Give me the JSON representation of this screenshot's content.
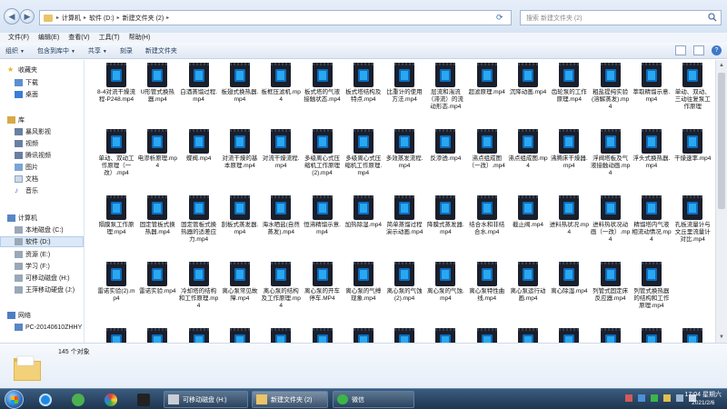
{
  "address": {
    "crumbs": [
      "计算机",
      "软件 (D:)",
      "新建文件夹 (2)"
    ],
    "search_placeholder": "搜索 新建文件夹 (2)"
  },
  "menu": [
    "文件(F)",
    "编辑(E)",
    "查看(V)",
    "工具(T)",
    "帮助(H)"
  ],
  "toolbar": {
    "organize": "组织",
    "include": "包含到库中",
    "share": "共享",
    "burn": "刻录",
    "new_folder": "新建文件夹"
  },
  "nav": {
    "favorites": "收藏夹",
    "downloads": "下载",
    "desktop": "桌面",
    "library": "库",
    "storm": "暴风影视",
    "video": "视频",
    "tencent": "腾讯视频",
    "pictures": "图片",
    "documents": "文档",
    "music": "音乐",
    "computer": "计算机",
    "disk_c": "本地磁盘 (C:)",
    "disk_d": "软件 (D:)",
    "disk_e": "资源 (E:)",
    "disk_f": "学习 (F:)",
    "disk_h": "可移动磁盘 (H:)",
    "disk_j": "王萍移动硬盘 (J:)",
    "network": "网络",
    "pc": "PC-20140610ZHHY"
  },
  "files": [
    "8-4对流干燥流程-P248.mp4",
    "U形管式换热器.mp4",
    "白酒蒸馏过程.mp4",
    "板翅式换热器.mp4",
    "板框压滤机.mp4",
    "板式塔的气液接触状态.mp4",
    "板式塔结构及特点.mp4",
    "比重计的使用方法.mp4",
    "层流和湍流（滞流）的流动形态.mp4",
    "超滤原理.mp4",
    "沉降动画.mp4",
    "齿轮泵的工作原理.mp4",
    "粗盐提纯实验(溶解蒸发).mp4",
    "萃取精馏示意.mp4",
    "单动、双动、三动往复泵工作原理",
    "单动、双动工作原理（一改）.mp4",
    "电渗析原理.mp4",
    "蝶阀.mp4",
    "对流干燥的基本原理.mp4",
    "对流干燥流程.mp4",
    "多级离心式压缩机工作原理(2).mp4",
    "多级离心式压缩机工作原理.mp4",
    "多效蒸发流程.mp4",
    "反渗透.mp4",
    "沸点组成图（一改）.mp4",
    "沸点组成图.mp4",
    "沸腾床干燥器.mp4",
    "浮阀塔板及气液接触动画.mp4",
    "浮头式换热器.mp4",
    "干燥速率.mp4",
    "隔膜泵工作原理.mp4",
    "固定管板式换热器.mp4",
    "固定管板式换热器的适差应力.mp4",
    "刮板式蒸发器.mp4",
    "海水晒盐(自然蒸发).mp4",
    "恒沸精馏示意.mp4",
    "加热除湿.mp4",
    "简单蒸馏过程演示动画.mp4",
    "降膜式蒸发器.mp4",
    "结合水和非结合水.mp4",
    "截止阀.mp4",
    "进料热状况.mp4",
    "进料热状况动画（一改）.mp4",
    "精馏塔内气液相流动情况.mp4",
    "孔板流量计与文丘里流量计对比.mp4",
    "雷诺实验(2).mp4",
    "雷诺实验.mp4",
    "冷却塔的结构和工作原理.mp4",
    "离心泵常见故障.mp4",
    "离心泵的结构及工作原理.mp4",
    "离心泵的开车停车.MP4",
    "离心泵的气缚现象.mp4",
    "离心泵的气蚀 (2).mp4",
    "离心泵的气蚀.mp4",
    "离心泵特性曲线.mp4",
    "离心泵运行动画.mp4",
    "离心除湿.mp4",
    "列管式固定床反应器.mp4",
    "列管式换热器的结构和工作原理.mp4"
  ],
  "details": {
    "count": "145 个对象"
  },
  "taskbar": {
    "task1": "可移动磁盘 (H:)",
    "task2": "新建文件夹 (2)",
    "task3": "微信",
    "time": "17:04 星期六",
    "date": "2021/2/6"
  }
}
